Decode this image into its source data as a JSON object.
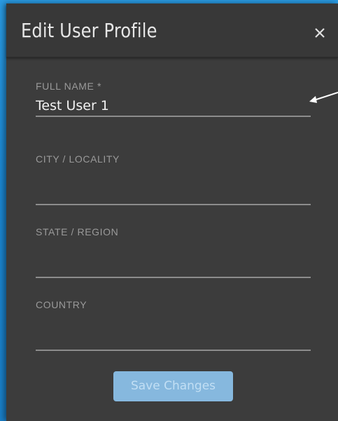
{
  "dialog": {
    "title": "Edit User Profile",
    "close_icon": "close-icon",
    "fields": [
      {
        "label": "FULL NAME *",
        "value": "Test User 1",
        "placeholder": ""
      },
      {
        "label": "CITY / LOCALITY",
        "value": "",
        "placeholder": ""
      },
      {
        "label": "STATE / REGION",
        "value": "",
        "placeholder": ""
      },
      {
        "label": "COUNTRY",
        "value": "",
        "placeholder": ""
      }
    ],
    "save_label": "Save Changes"
  },
  "colors": {
    "backdrop": "#1f8fd8",
    "dialog_background": "#3c3c3c",
    "save_button": "#86b8de"
  }
}
